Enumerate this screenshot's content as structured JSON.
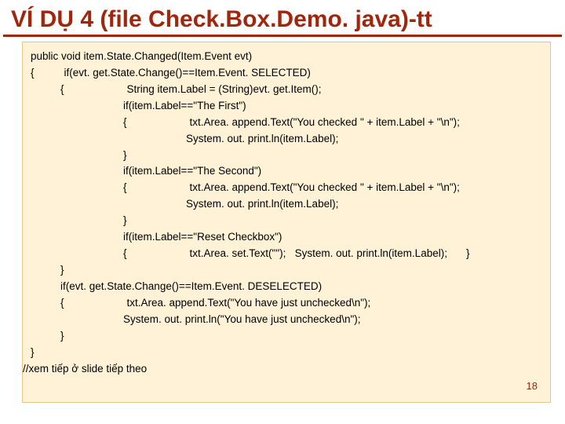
{
  "title": "VÍ DỤ 4 (file Check.Box.Demo. java)-tt",
  "code": {
    "l1": "public void item.State.Changed(Item.Event evt)",
    "l2": "{",
    "l2b": "if(evt. get.State.Change()==Item.Event. SELECTED)",
    "l3": "{",
    "l3b": "String item.Label = (String)evt. get.Item();",
    "l4": "if(item.Label==\"The First\")",
    "l5": "{",
    "l5b": "txt.Area. append.Text(\"You checked \" + item.Label + \"\\n\");",
    "l6": "System. out. print.ln(item.Label);",
    "l7": "}",
    "l8": "if(item.Label==\"The Second\")",
    "l9": "{",
    "l9b": "txt.Area. append.Text(\"You checked \" + item.Label + \"\\n\");",
    "l10": "System. out. print.ln(item.Label);",
    "l11": "}",
    "l12": "if(item.Label==\"Reset Checkbox\")",
    "l13": "{",
    "l13b": "txt.Area. set.Text(\"\");   System. out. print.ln(item.Label);",
    "l13c": "}",
    "l14": "}",
    "l15": "if(evt. get.State.Change()==Item.Event. DESELECTED)",
    "l16": "{",
    "l16b": "txt.Area. append.Text(\"You have just unchecked\\n\");",
    "l17": "System. out. print.ln(\"You have just unchecked\\n\");",
    "l18": "}",
    "l19": "}",
    "l20": "//xem tiếp ở slide tiếp theo"
  },
  "page_number": "18"
}
